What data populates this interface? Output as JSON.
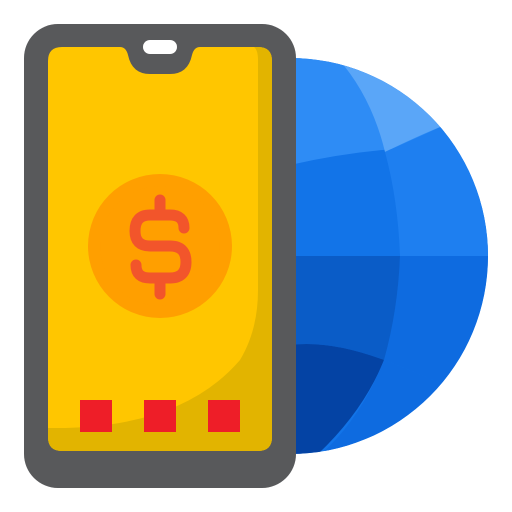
{
  "icon": {
    "name": "mobile-global-payment-icon",
    "parts": [
      "globe-icon",
      "smartphone-icon",
      "dollar-coin-icon",
      "menu-dots-icon"
    ]
  },
  "colors": {
    "phone_frame": "#58595b",
    "screen_yellow": "#ffc600",
    "screen_shadow": "#e2b400",
    "notch_white": "#ffffff",
    "coin_outer": "#ff9f00",
    "coin_inner": "#ff8500",
    "dollar_sign": "#f2552b",
    "dot_red": "#ee1e28",
    "globe_light": "#2e8cf5",
    "globe_mid": "#1274e8",
    "globe_dark": "#0a5cc7",
    "globe_highlight": "#5aa6f8",
    "globe_deep": "#0443a4"
  }
}
